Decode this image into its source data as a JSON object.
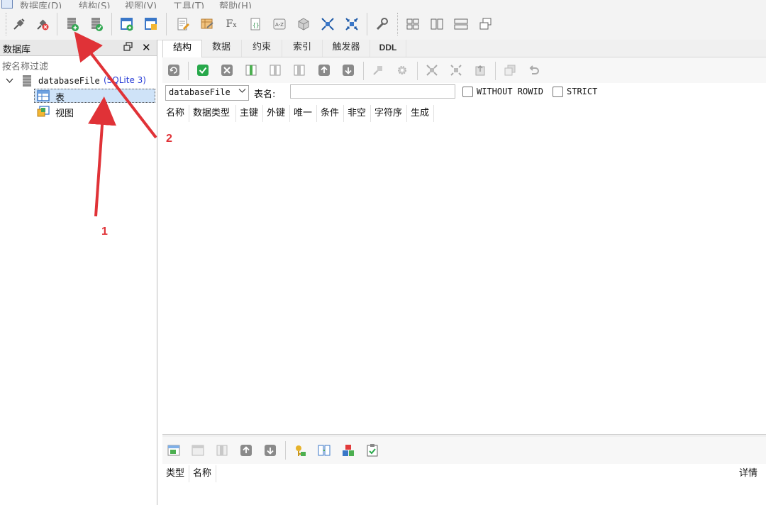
{
  "menu": {
    "items": [
      "数据库(D)",
      "结构(S)",
      "视图(V)",
      "工具(T)",
      "帮助(H)"
    ]
  },
  "toolbar": {
    "icons": [
      "connect-icon",
      "disconnect-icon",
      "new-table-icon",
      "edit-table-icon",
      "new-view-icon",
      "edit-view-icon",
      "sql-editor-icon",
      "query-builder-icon",
      "function-icon",
      "script-icon",
      "compare-icon",
      "cube-icon",
      "expand-icon",
      "collapse-icon",
      "wrench-icon",
      "grid-layout-icon",
      "split-vertical-icon",
      "split-horizontal-icon",
      "cascade-window-icon"
    ]
  },
  "dock": {
    "title": "数据库",
    "filter_placeholder": "按名称过滤",
    "tree": {
      "db_name": "databaseFile",
      "db_type": "(SQLite 3)",
      "children": [
        "表",
        "视图"
      ]
    }
  },
  "tabs": {
    "items": [
      "结构",
      "数据",
      "约束",
      "索引",
      "触发器",
      "DDL"
    ],
    "active_index": 0
  },
  "editor": {
    "schema_value": "databaseFile",
    "table_name_label": "表名:",
    "table_name_value": "",
    "without_rowid_label": "WITHOUT ROWID",
    "strict_label": "STRICT",
    "columns_headers": [
      "名称",
      "数据类型",
      "主键",
      "外键",
      "唯一",
      "条件",
      "非空",
      "字符序",
      "生成"
    ]
  },
  "bottom": {
    "headers": [
      "类型",
      "名称",
      "详情"
    ]
  },
  "annotations": {
    "label_1": "1",
    "label_2": "2",
    "color": "#e03237"
  }
}
